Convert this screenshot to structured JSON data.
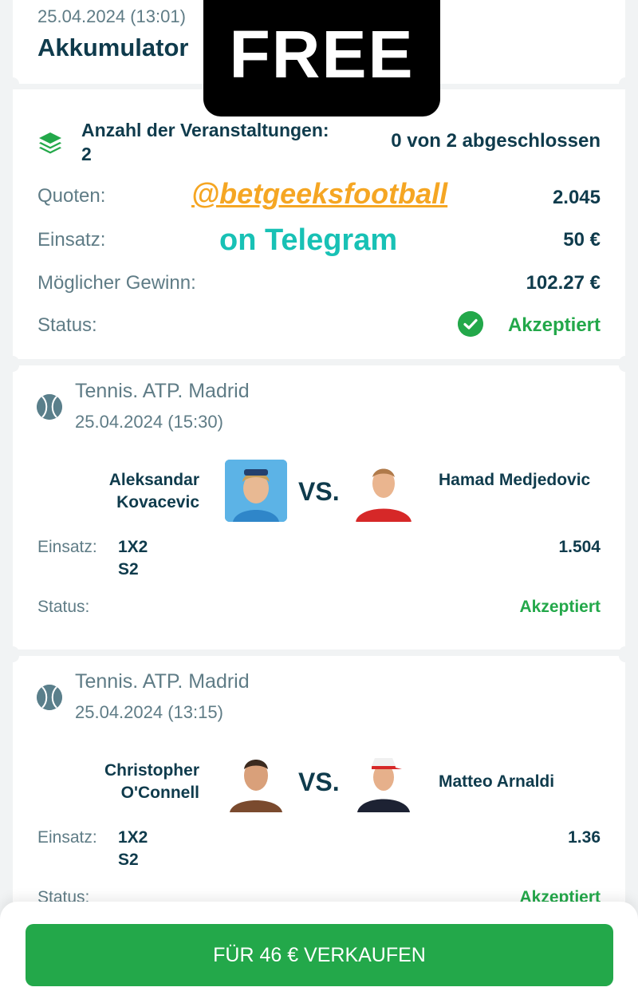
{
  "header": {
    "date": "25.04.2024 (13:01)",
    "title": "Akkumulator"
  },
  "summary": {
    "events_label": "Anzahl der Veranstaltungen:",
    "events_count": "2",
    "completed": "0 von 2 abgeschlossen",
    "rows": [
      {
        "label": "Quoten:",
        "value": "2.045"
      },
      {
        "label": "Einsatz:",
        "value": "50 €"
      },
      {
        "label": "Möglicher Gewinn:",
        "value": "102.27 €"
      },
      {
        "label": "Status:",
        "value": "Akzeptiert"
      }
    ]
  },
  "events": [
    {
      "league": "Tennis. ATP. Madrid",
      "date": "25.04.2024 (15:30)",
      "player1": "Aleksandar Kovacevic",
      "player2": "Hamad Medjedovic",
      "vs": "VS.",
      "bet_label": "Einsatz:",
      "bet_market": "1X2",
      "bet_pick": "S2",
      "odd": "1.504",
      "status_label": "Status:",
      "status": "Akzeptiert"
    },
    {
      "league": "Tennis. ATP. Madrid",
      "date": "25.04.2024 (13:15)",
      "player1": "Christopher O'Connell",
      "player2": "Matteo Arnaldi",
      "vs": "VS.",
      "bet_label": "Einsatz:",
      "bet_market": "1X2",
      "bet_pick": "S2",
      "odd": "1.36",
      "status_label": "Status:",
      "status": "Akzeptiert"
    }
  ],
  "overlay": {
    "free": "FREE",
    "handle": "@betgeeksfootball",
    "telegram": "on Telegram"
  },
  "footer": {
    "sell_button": "FÜR 46 € VERKAUFEN"
  },
  "colors": {
    "accent_green": "#23a84a",
    "text_dark": "#0f3b4c",
    "text_muted": "#5f7c86",
    "handle_orange": "#f5a623",
    "telegram_teal": "#18c1b5"
  },
  "icons": [
    "layers-icon",
    "check-circle-icon",
    "tennis-ball-icon"
  ]
}
